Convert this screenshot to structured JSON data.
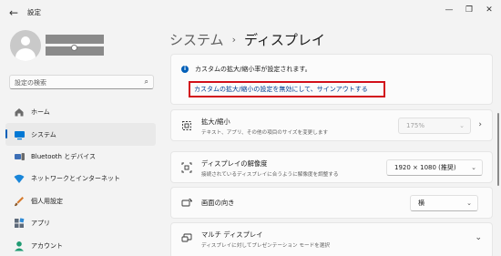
{
  "window": {
    "title": "設定"
  },
  "sidebar": {
    "search_placeholder": "設定の検索",
    "items": [
      {
        "label": "ホーム",
        "icon": "home-icon"
      },
      {
        "label": "システム",
        "icon": "system-icon",
        "active": true
      },
      {
        "label": "Bluetooth とデバイス",
        "icon": "bluetooth-icon"
      },
      {
        "label": "ネットワークとインターネット",
        "icon": "network-icon"
      },
      {
        "label": "個人用設定",
        "icon": "personalization-icon"
      },
      {
        "label": "アプリ",
        "icon": "apps-icon"
      },
      {
        "label": "アカウント",
        "icon": "account-icon"
      }
    ]
  },
  "main": {
    "breadcrumb_parent": "システム",
    "breadcrumb_sep": "›",
    "breadcrumb_current": "ディスプレイ",
    "notice": {
      "text": "カスタムの拡大/縮小率が設定されます。",
      "link": "カスタムの拡大/縮小の設定を無効にして、サインアウトする"
    },
    "rows": [
      {
        "title": "拡大/縮小",
        "subtitle": "テキスト、アプリ、その他の項目のサイズを変更します",
        "value": "175%",
        "disabled": true
      },
      {
        "title": "ディスプレイの解像度",
        "subtitle": "接続されているディスプレイに合うように解像度を調整する",
        "value": "1920 × 1080 (推奨)"
      },
      {
        "title": "画面の向き",
        "value": "横"
      },
      {
        "title": "マルチ ディスプレイ",
        "subtitle": "ディスプレイに対してプレゼンテーション モードを選択"
      }
    ]
  },
  "colors": {
    "accent": "#005fb8",
    "link": "#003e92",
    "highlight_box": "#d2101b"
  }
}
